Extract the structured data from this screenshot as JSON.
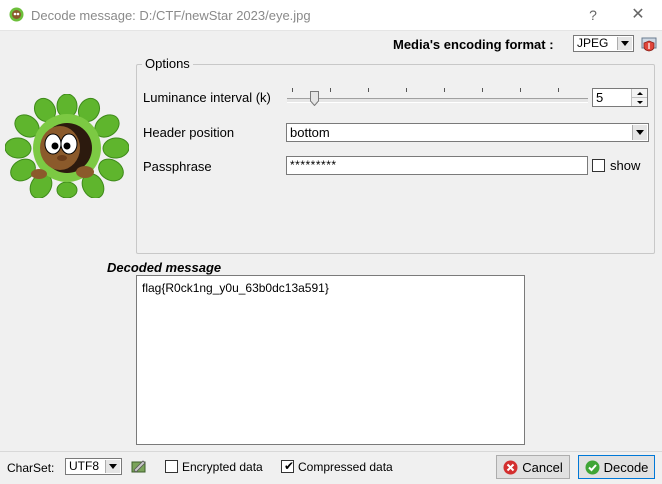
{
  "window": {
    "title": "Decode message: D:/CTF/newStar 2023/eye.jpg",
    "help_label": "?",
    "close_label": "✕"
  },
  "encoding": {
    "label": "Media's encoding format :",
    "value": "JPEG"
  },
  "options": {
    "legend": "Options",
    "luminance_label": "Luminance interval (k)",
    "luminance_value": "5",
    "header_label": "Header position",
    "header_value": "bottom",
    "passphrase_label": "Passphrase",
    "passphrase_value": "*********",
    "show_label": "show",
    "show_checked": false
  },
  "decoded": {
    "label": "Decoded message",
    "text": "flag{R0ck1ng_y0u_63b0dc13a591}"
  },
  "bottom_bar": {
    "charset_label": "CharSet:",
    "charset_value": "UTF8",
    "encrypted_label": "Encrypted data",
    "encrypted_checked": false,
    "compressed_label": "Compressed data",
    "compressed_checked": true,
    "cancel_label": "Cancel",
    "decode_label": "Decode"
  },
  "colors": {
    "window_bg": "#f0f0f0",
    "accent": "#0078d7",
    "cancel_icon": "#d32f2f",
    "decode_icon": "#3fa535"
  }
}
